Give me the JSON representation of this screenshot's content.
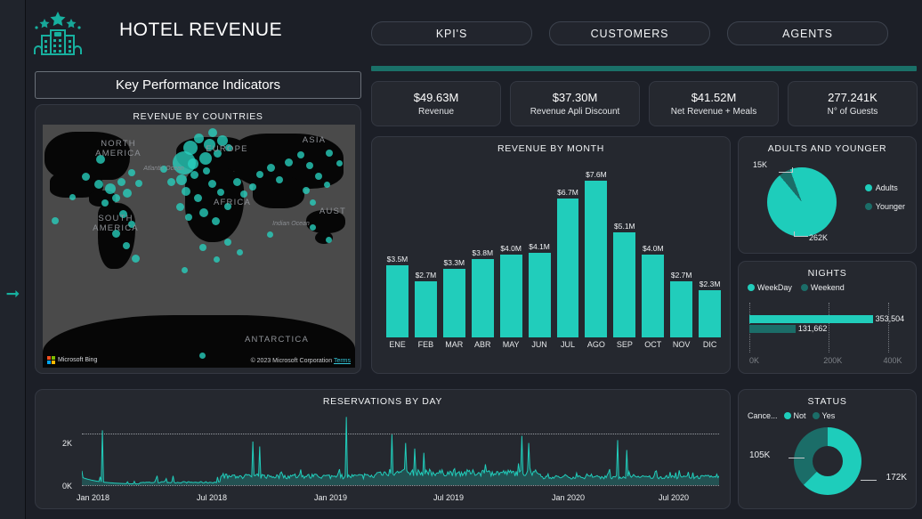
{
  "header": {
    "title": "HOTEL REVENUE",
    "logo_icon": "hotel-building-stars-icon",
    "tabs": [
      {
        "label": "KPI'S"
      },
      {
        "label": "CUSTOMERS"
      },
      {
        "label": "AGENTS"
      }
    ]
  },
  "sidebar": {
    "expand_icon": "arrow-right-icon"
  },
  "left": {
    "banner_title": "Key Performance Indicators",
    "map": {
      "title": "REVENUE BY COUNTRIES",
      "continents": [
        "NORTH AMERICA",
        "SOUTH AMERICA",
        "EUROPE",
        "ASIA",
        "AFRICA",
        "AUST",
        "ANTARCTICA"
      ],
      "oceans": [
        "Atlantic Ocean",
        "Indian Ocean"
      ],
      "provider": "Microsoft Bing",
      "copyright": "© 2023 Microsoft Corporation",
      "terms_label": "Terms"
    }
  },
  "kpis": [
    {
      "value": "$49.63M",
      "label": "Revenue"
    },
    {
      "value": "$37.30M",
      "label": "Revenue Apli Discount"
    },
    {
      "value": "$41.52M",
      "label": "Net Revenue + Meals"
    },
    {
      "value": "277.241K",
      "label": "N° of Guests"
    }
  ],
  "colors": {
    "accent": "#21cdbb",
    "accent_dark": "#1b6d68",
    "divider": "#1a7068",
    "card_bg": "#25282f",
    "page_bg": "#1c1f27"
  },
  "chart_data": [
    {
      "type": "bar",
      "title": "REVENUE BY MONTH",
      "categories": [
        "ENE",
        "FEB",
        "MAR",
        "ABR",
        "MAY",
        "JUN",
        "JUL",
        "AGO",
        "SEP",
        "OCT",
        "NOV",
        "DIC"
      ],
      "values": [
        3.5,
        2.7,
        3.3,
        3.8,
        4.0,
        4.1,
        6.7,
        7.6,
        5.1,
        4.0,
        2.7,
        2.3
      ],
      "labels": [
        "$3.5M",
        "$2.7M",
        "$3.3M",
        "$3.8M",
        "$4.0M",
        "$4.1M",
        "$6.7M",
        "$7.6M",
        "$5.1M",
        "$4.0M",
        "$2.7M",
        "$2.3M"
      ],
      "xlabel": "",
      "ylabel": "",
      "ylim": [
        0,
        8.4
      ],
      "grid": false,
      "series_color": "#21cdbb"
    },
    {
      "type": "pie",
      "title": "ADULTS AND YOUNGER",
      "categories": [
        "Adults",
        "Younger"
      ],
      "values": [
        262000,
        15000
      ],
      "labels": [
        "262K",
        "15K"
      ],
      "legend": [
        "Adults",
        "Younger"
      ],
      "legend_position": "right",
      "colors": [
        "#1ecdbb",
        "#1b6d68"
      ]
    },
    {
      "type": "bar",
      "orientation": "horizontal",
      "title": "NIGHTS",
      "categories": [
        "WeekDay",
        "Weekend"
      ],
      "values": [
        353504,
        131662
      ],
      "labels": [
        "353,504",
        "131,662"
      ],
      "legend": [
        "WeekDay",
        "Weekend"
      ],
      "xticks": [
        "0K",
        "200K",
        "400K"
      ],
      "xlim": [
        0,
        450000
      ],
      "grid": true,
      "colors": [
        "#21cdbb",
        "#1b6d68"
      ]
    },
    {
      "type": "line",
      "title": "RESERVATIONS BY DAY",
      "xticks": [
        "Jan 2018",
        "Jul 2018",
        "Jan 2019",
        "Jul 2019",
        "Jan 2020",
        "Jul 2020"
      ],
      "yticks": [
        "0K",
        "2K"
      ],
      "ylim": [
        0,
        2600
      ],
      "grid": true,
      "series_color": "#21cdbb"
    },
    {
      "type": "pie",
      "subtype": "donut",
      "title": "STATUS",
      "legend_title": "Cance...",
      "categories": [
        "Not",
        "Yes"
      ],
      "values": [
        172000,
        105000
      ],
      "labels": [
        "172K",
        "105K"
      ],
      "legend": [
        "Not",
        "Yes"
      ],
      "colors": [
        "#1ecdbb",
        "#1b6d68"
      ]
    }
  ]
}
